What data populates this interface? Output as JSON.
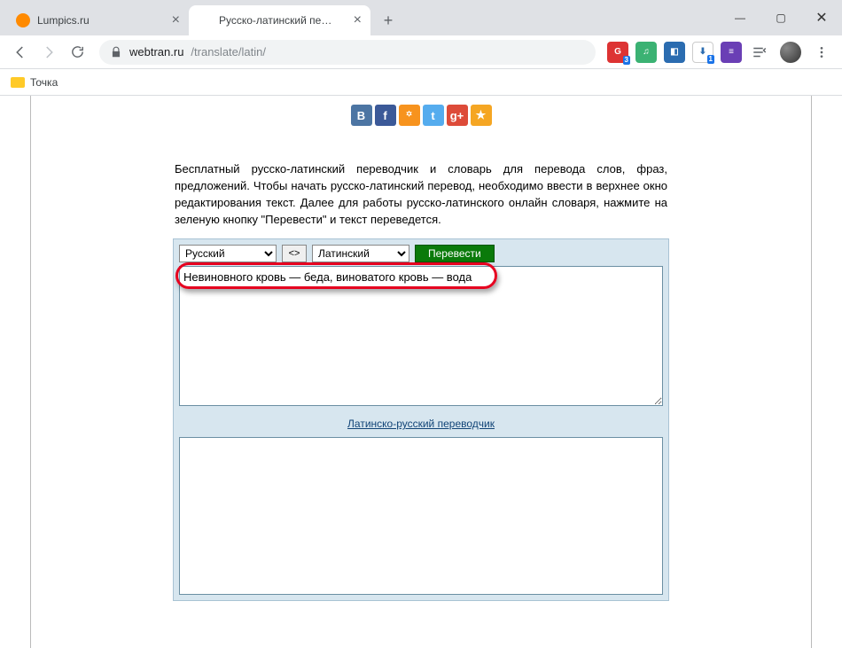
{
  "window": {
    "min": "—",
    "max": "▢",
    "close": "✕"
  },
  "tabs": [
    {
      "title": "Lumpics.ru",
      "active": false
    },
    {
      "title": "Русско-латинский переводчик",
      "active": true
    }
  ],
  "toolbar": {
    "secure_host": "webtran.ru",
    "url_path": "/translate/latin/"
  },
  "bookmarks": {
    "folder1": "Точка"
  },
  "social": {
    "vk": "B",
    "fb": "f",
    "ok": "꙳",
    "tw": "t",
    "gp": "g+",
    "fav": "★"
  },
  "page": {
    "intro": "Бесплатный русско-латинский переводчик и словарь для перевода слов, фраз, предложений. Чтобы начать русско-латинский перевод, необходимо ввести в верхнее окно редактирования текст. Далее для работы русско-латинского онлайн словаря, нажмите на зеленую кнопку \"Перевести\" и текст переведется.",
    "lang_from": "Русский",
    "lang_to": "Латинский",
    "swap": "<>",
    "translate_btn": "Перевести",
    "input_text": "Невиновного кровь — беда, виноватого кровь — вода",
    "reverse_link": "Латинско-русский переводчик"
  }
}
